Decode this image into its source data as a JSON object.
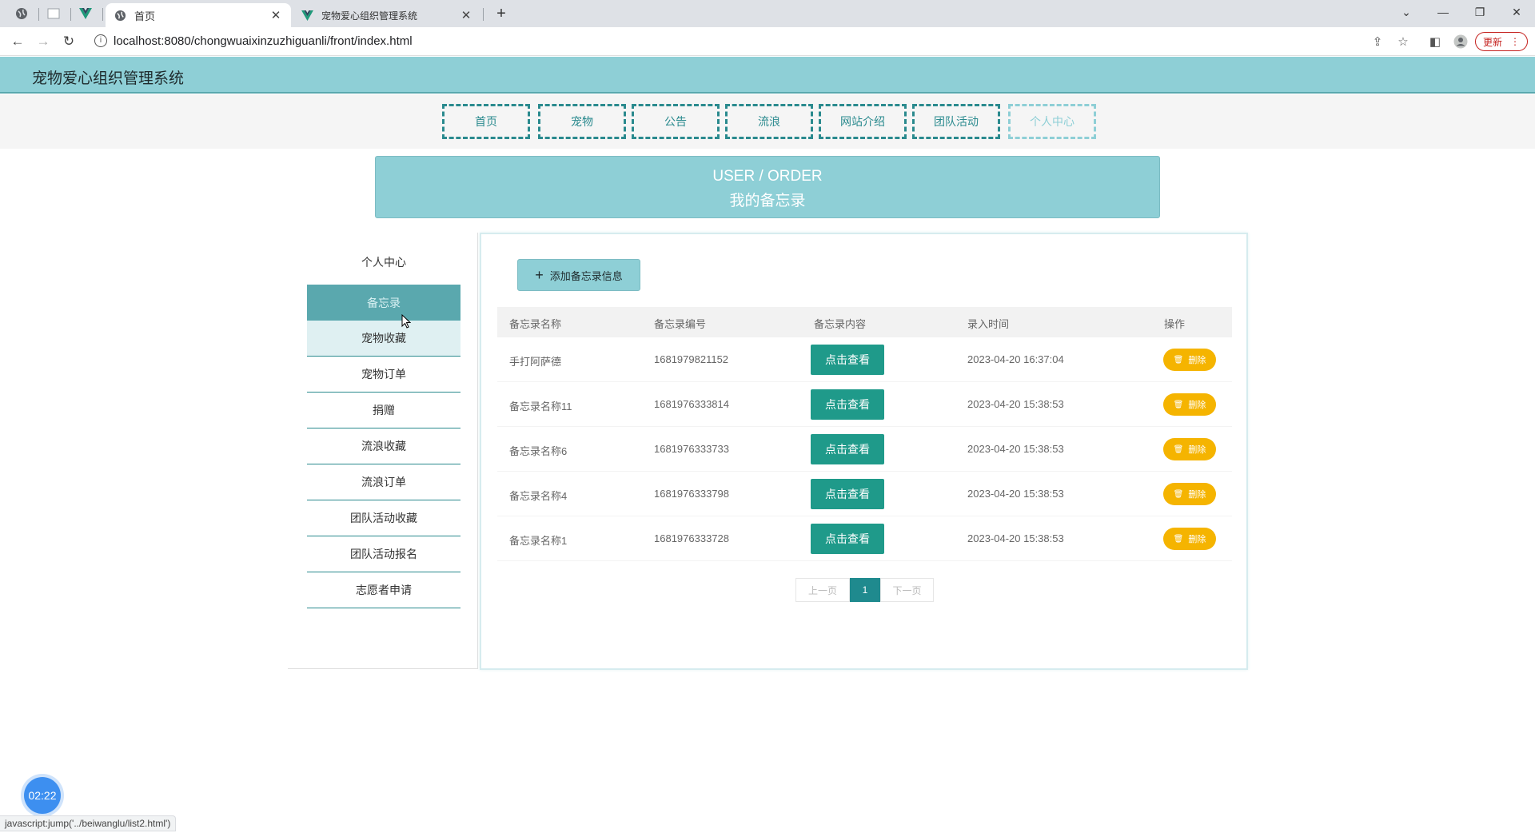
{
  "browser": {
    "tabs": [
      {
        "title": "首页",
        "active": true
      },
      {
        "title": "宠物爱心组织管理系统",
        "active": false
      }
    ],
    "url": "localhost:8080/chongwuaixinzuzhiguanli/front/index.html",
    "update_label": "更新",
    "status_url": "javascript:jump('../beiwanglu/list2.html')"
  },
  "site": {
    "title": "宠物爱心组织管理系统",
    "nav": [
      "首页",
      "宠物",
      "公告",
      "流浪",
      "网站介绍",
      "团队活动",
      "个人中心"
    ],
    "active_nav": "个人中心"
  },
  "banner": {
    "en": "USER / ORDER",
    "cn": "我的备忘录"
  },
  "sidebar": {
    "head": "个人中心",
    "items": [
      "备忘录",
      "宠物收藏",
      "宠物订单",
      "捐赠",
      "流浪收藏",
      "流浪订单",
      "团队活动收藏",
      "团队活动报名",
      "志愿者申请"
    ],
    "active": "备忘录",
    "hover": "宠物收藏"
  },
  "panel": {
    "add_label": "添加备忘录信息",
    "columns": [
      "备忘录名称",
      "备忘录编号",
      "备忘录内容",
      "录入时间",
      "操作"
    ],
    "view_label": "点击查看",
    "delete_label": "删除",
    "rows": [
      {
        "name": "手打阿萨德",
        "code": "1681979821152",
        "time": "2023-04-20 16:37:04"
      },
      {
        "name": "备忘录名称11",
        "code": "1681976333814",
        "time": "2023-04-20 15:38:53"
      },
      {
        "name": "备忘录名称6",
        "code": "1681976333733",
        "time": "2023-04-20 15:38:53"
      },
      {
        "name": "备忘录名称4",
        "code": "1681976333798",
        "time": "2023-04-20 15:38:53"
      },
      {
        "name": "备忘录名称1",
        "code": "1681976333728",
        "time": "2023-04-20 15:38:53"
      }
    ]
  },
  "pager": {
    "prev": "上一页",
    "current": "1",
    "next": "下一页"
  },
  "timer": "02:22",
  "colors": {
    "header": "#8ecfd6",
    "accent": "#1f9a8a",
    "delete": "#f5b400",
    "sidebar_active": "#5aa8ae"
  }
}
